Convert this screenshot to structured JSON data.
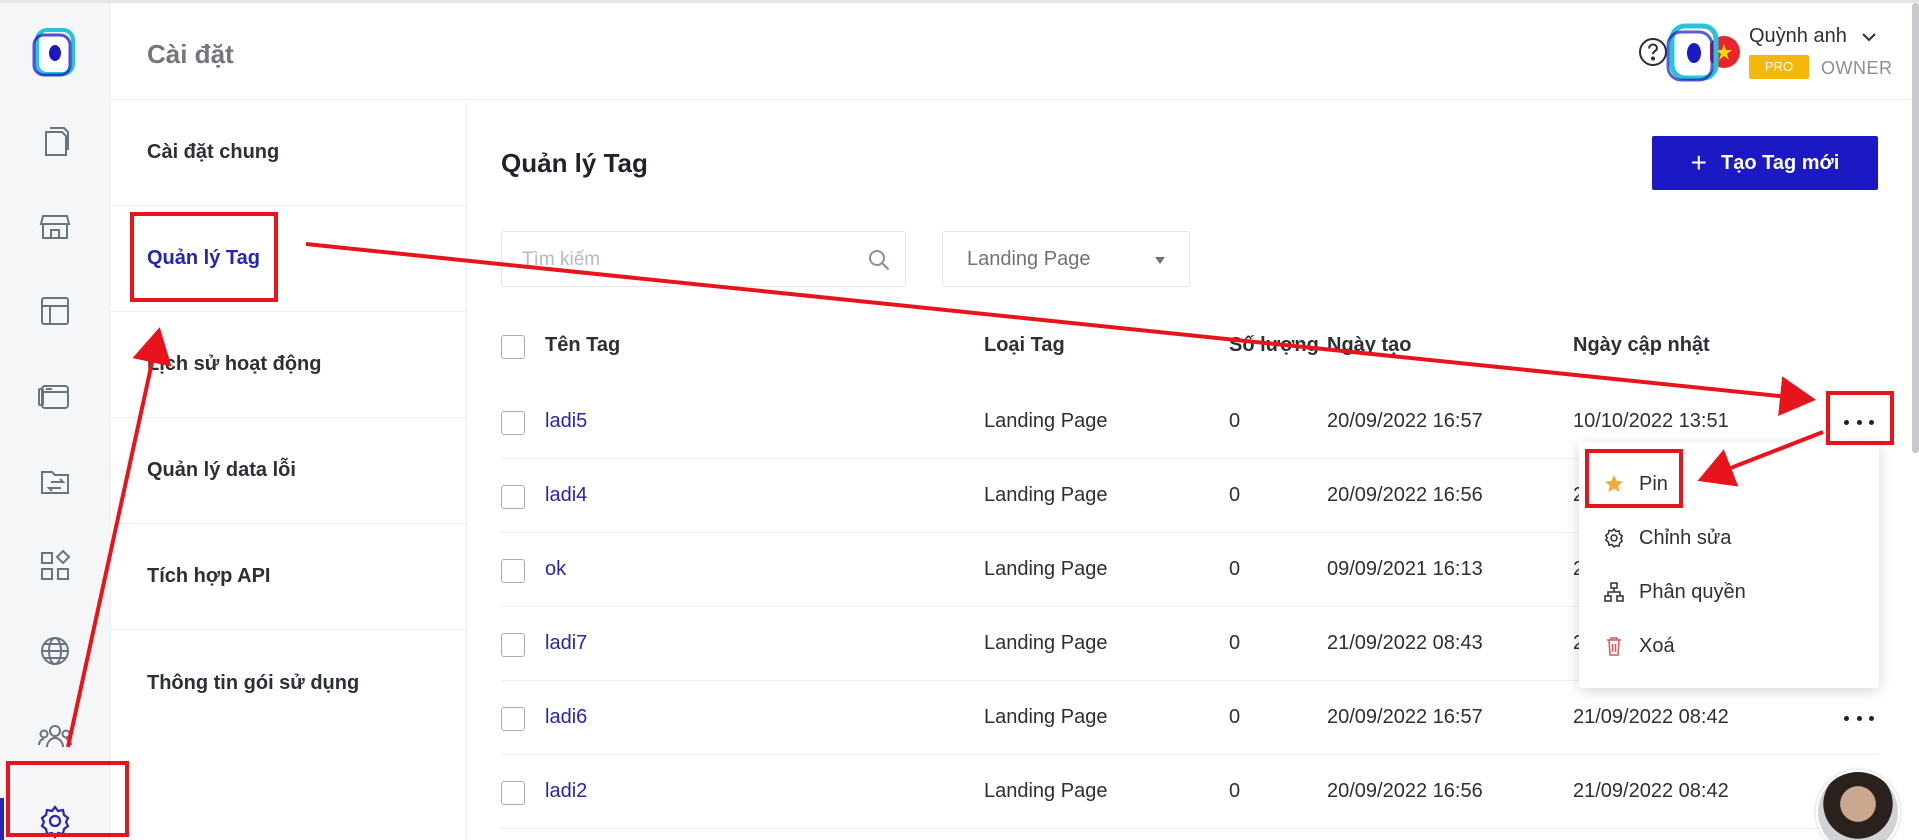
{
  "header": {
    "title": "Cài đặt",
    "user_name": "Quỳnh anh",
    "plan_badge": "PRO",
    "role": "OWNER",
    "icons": [
      "help-icon",
      "flag-vn-icon",
      "chevron-down-icon"
    ]
  },
  "rail": {
    "icons": [
      "logo",
      "pages-icon",
      "store-icon",
      "template-icon",
      "browser-icon",
      "folder-transfer-icon",
      "apps-icon",
      "globe-icon",
      "team-icon",
      "settings-icon"
    ]
  },
  "submenu": {
    "items": [
      {
        "label": "Cài đặt chung"
      },
      {
        "label": "Quản lý Tag"
      },
      {
        "label": "Lịch sử hoạt động"
      },
      {
        "label": "Quản lý data lỗi"
      },
      {
        "label": "Tích hợp API"
      },
      {
        "label": "Thông tin gói sử dụng"
      }
    ]
  },
  "main": {
    "title": "Quản lý Tag",
    "create_button": "Tạo Tag mới",
    "search_placeholder": "Tìm kiếm",
    "filter_value": "Landing Page",
    "columns": [
      "Tên Tag",
      "Loại Tag",
      "Số lượng",
      "Ngày tạo",
      "Ngày cập nhật"
    ],
    "rows": [
      {
        "name": "ladi5",
        "type": "Landing Page",
        "count": "0",
        "created": "20/09/2022 16:57",
        "updated": "10/10/2022 13:51"
      },
      {
        "name": "ladi4",
        "type": "Landing Page",
        "count": "0",
        "created": "20/09/2022 16:56",
        "updated": "2"
      },
      {
        "name": "ok",
        "type": "Landing Page",
        "count": "0",
        "created": "09/09/2021 16:13",
        "updated": "2"
      },
      {
        "name": "ladi7",
        "type": "Landing Page",
        "count": "0",
        "created": "21/09/2022 08:43",
        "updated": "2"
      },
      {
        "name": "ladi6",
        "type": "Landing Page",
        "count": "0",
        "created": "20/09/2022 16:57",
        "updated": "21/09/2022 08:42"
      },
      {
        "name": "ladi2",
        "type": "Landing Page",
        "count": "0",
        "created": "20/09/2022 16:56",
        "updated": "21/09/2022 08:42"
      }
    ]
  },
  "dropdown": {
    "items": [
      {
        "label": "Pin",
        "icon": "star-icon"
      },
      {
        "label": "Chỉnh sửa",
        "icon": "gear-icon"
      },
      {
        "label": "Phân quyền",
        "icon": "hierarchy-icon"
      },
      {
        "label": "Xoá",
        "icon": "trash-icon"
      }
    ]
  },
  "colors": {
    "primary": "#1b18c4",
    "link": "#2326b5",
    "annotation": "#e8141b",
    "pro_badge": "#f5b80a"
  }
}
